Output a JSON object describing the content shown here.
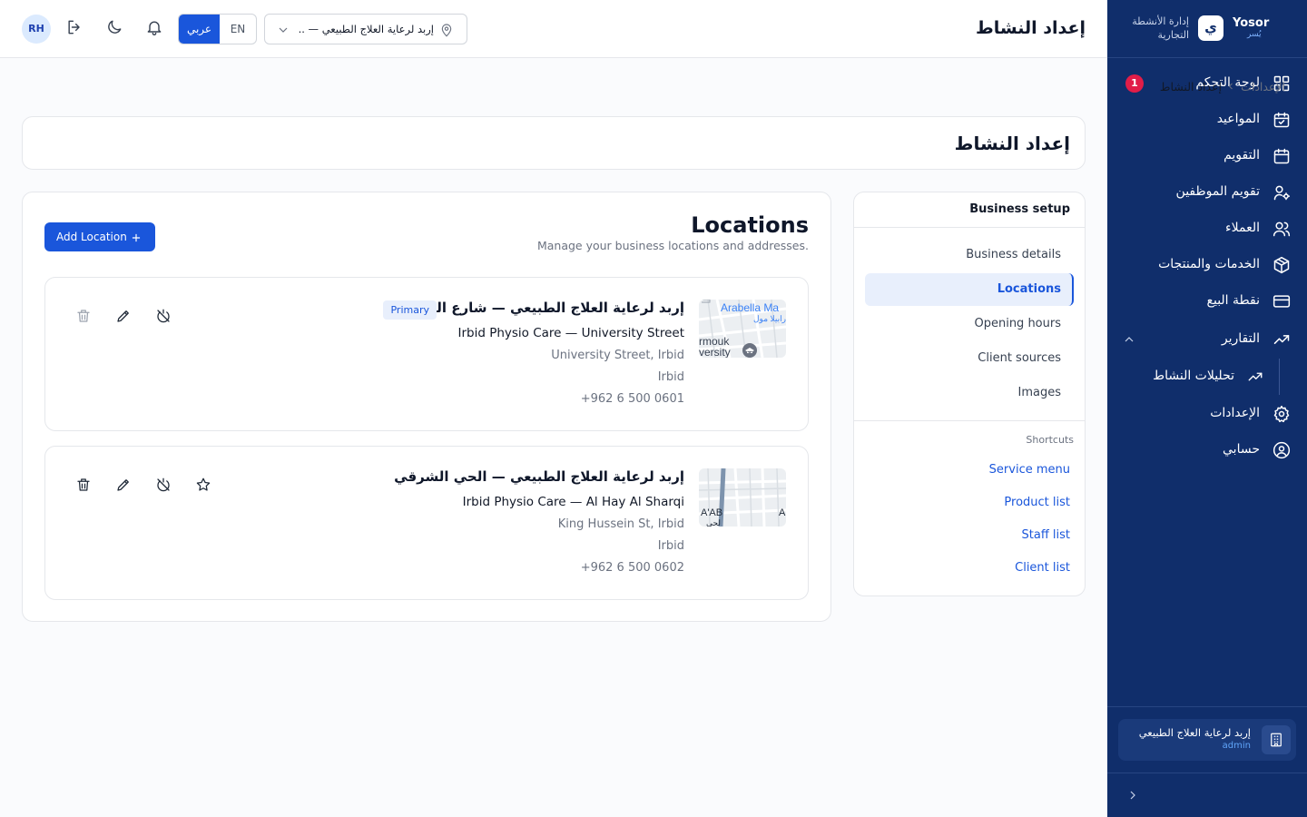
{
  "brand": {
    "name": "Yosor",
    "sub": "يُسر",
    "logo_letter": "ي",
    "tagline": "إدارة الأنشطة التجارية"
  },
  "sidebar": {
    "items": [
      {
        "label": "لوحة التحكم",
        "icon": "dashboard-grid-icon",
        "badge": "1"
      },
      {
        "label": "المواعيد",
        "icon": "calendar-check-icon"
      },
      {
        "label": "التقويم",
        "icon": "calendar-icon"
      },
      {
        "label": "تقويم الموظفين",
        "icon": "user-gear-icon"
      },
      {
        "label": "العملاء",
        "icon": "users-icon"
      },
      {
        "label": "الخدمات والمنتجات",
        "icon": "box-icon"
      },
      {
        "label": "نقطة البيع",
        "icon": "credit-card-icon"
      },
      {
        "label": "التقارير",
        "icon": "trending-up-icon",
        "expanded": true
      },
      {
        "label": "الإعدادات",
        "icon": "gear-icon"
      },
      {
        "label": "حسابي",
        "icon": "user-circle-icon"
      }
    ],
    "subitems": [
      {
        "label": "تحليلات النشاط",
        "icon": "trending-up-icon"
      }
    ],
    "account": {
      "name": "إربد لرعاية العلاج الطبيعي",
      "role": "admin",
      "icon": "building-icon"
    }
  },
  "topbar": {
    "title": "إعداد النشاط",
    "avatar": "RH",
    "lang_ar": "عربي",
    "lang_en": "EN",
    "location_value": "إربد لرعاية العلاج الطبيعي — ...",
    "icons": [
      "logout-icon",
      "moon-icon",
      "bell-icon"
    ]
  },
  "breadcrumb": {
    "root": "الإعدادات",
    "current": "إعداد النشاط"
  },
  "page": {
    "title": "إعداد النشاط"
  },
  "setup_nav": {
    "title": "Business setup",
    "items": [
      {
        "label": "Business details",
        "active": false
      },
      {
        "label": "Locations",
        "active": true
      },
      {
        "label": "Opening hours",
        "active": false
      },
      {
        "label": "Client sources",
        "active": false
      },
      {
        "label": "Images",
        "active": false
      }
    ],
    "shortcuts_title": "Shortcuts",
    "shortcuts": [
      "Service menu",
      "Product list",
      "Staff list",
      "Client list"
    ]
  },
  "locations": {
    "title": "Locations",
    "subtitle": "Manage your business locations and addresses.",
    "add_button": "Add Location",
    "items": [
      {
        "name_ar": "إربد لرعاية العلاج الطبيعي — شارع الجامعة",
        "badge": "Primary",
        "name_en": "Irbid Physio Care — University Street",
        "address": "University Street, Irbid",
        "city": "Irbid",
        "phone": "+962 6 500 0601",
        "map_labels": [
          "Arabella Ma",
          "ارابيلا مول",
          "rmouk",
          "versity"
        ]
      },
      {
        "name_ar": "إربد لرعاية العلاج الطبيعي — الحي الشرقي",
        "badge": "",
        "name_en": "Irbid Physio Care — Al Hay Al Sharqi",
        "address": "King Hussein St, Irbid",
        "city": "Irbid",
        "phone": "+962 6 500 0602",
        "map_labels": [
          "A'AB",
          "A",
          "لحي"
        ]
      }
    ]
  },
  "colors": {
    "sidebar_bg": "#102e6b",
    "accent": "#1a56db",
    "badge_red": "#e11d48"
  }
}
